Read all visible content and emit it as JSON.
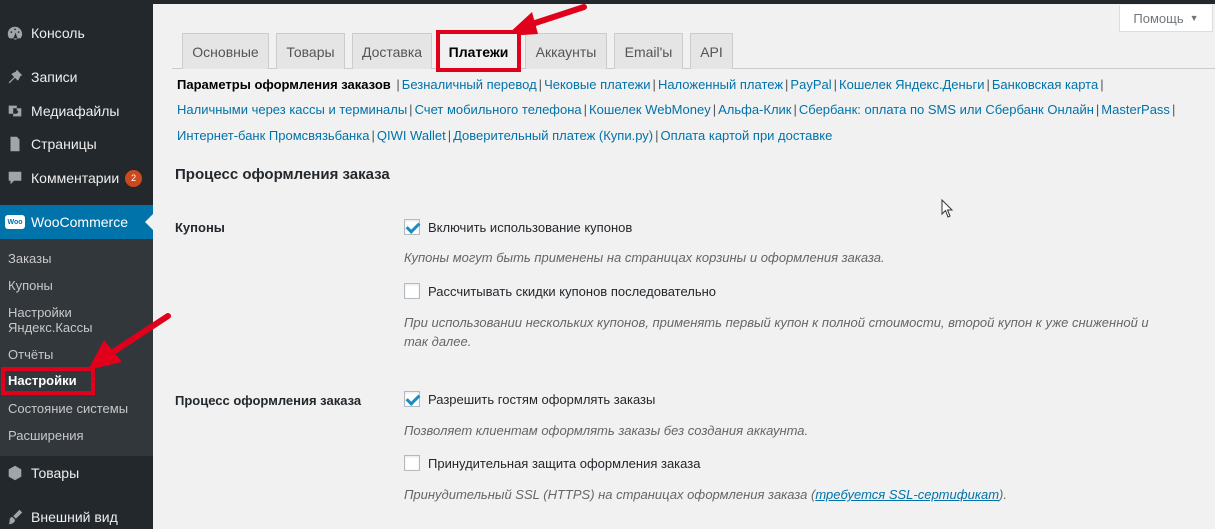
{
  "sidebar": {
    "items": [
      {
        "label": "Консоль",
        "icon": "dashboard-icon"
      },
      {
        "label": "Записи",
        "icon": "pin-icon"
      },
      {
        "label": "Медиафайлы",
        "icon": "media-icon"
      },
      {
        "label": "Страницы",
        "icon": "page-icon"
      },
      {
        "label": "Комментарии",
        "icon": "comment-icon",
        "badge": "2"
      },
      {
        "label": "WooCommerce",
        "icon": "woo-logo-icon",
        "logo_text": "Woo"
      },
      {
        "label": "Товары",
        "icon": "product-box-icon"
      },
      {
        "label": "Внешний вид",
        "icon": "brush-icon"
      }
    ],
    "submenu": [
      "Заказы",
      "Купоны",
      "Настройки Яндекс.Кассы",
      "Отчёты",
      "Настройки",
      "Состояние системы",
      "Расширения"
    ]
  },
  "header": {
    "help_label": "Помощь",
    "help_caret": "▼"
  },
  "tabs": [
    "Основные",
    "Товары",
    "Доставка",
    "Платежи",
    "Аккаунты",
    "Email'ы",
    "API"
  ],
  "sections": {
    "current": "Параметры оформления заказов",
    "line1": [
      "Безналичный перевод",
      "Чековые платежи",
      "Наложенный платеж",
      "PayPal",
      "Кошелек Яндекс.Деньги",
      "Банковская карта"
    ],
    "line2": [
      "Наличными через кассы и терминалы",
      "Счет мобильного телефона",
      "Кошелек WebMoney",
      "Альфа-Клик",
      "Сбербанк: оплата по SMS или Сбербанк Онлайн",
      "MasterPass"
    ],
    "line3": [
      "Интернет-банк Промсвязьбанка",
      "QIWI Wallet",
      "Доверительный платеж (Купи.ру)",
      "Оплата картой при доставке"
    ],
    "separator": "|"
  },
  "form": {
    "heading": "Процесс оформления заказа",
    "coupons": {
      "label": "Купоны",
      "enable_label": "Включить использование купонов",
      "enable_checked": true,
      "enable_desc": "Купоны могут быть применены на страницах корзины и оформления заказа.",
      "sequential_label": "Рассчитывать скидки купонов последовательно",
      "sequential_checked": false,
      "sequential_desc_1": "При использовании нескольких купонов, применять первый купон к полной стоимости, второй купон к уже сниженной и",
      "sequential_desc_2": "так далее."
    },
    "checkout": {
      "label": "Процесс оформления заказа",
      "guest_label": "Разрешить гостям оформлять заказы",
      "guest_checked": true,
      "guest_desc": "Позволяет клиентам оформлять заказы без создания аккаунта.",
      "ssl_label": "Принудительная защита оформления заказа",
      "ssl_checked": false,
      "ssl_desc_prefix": "Принудительный SSL (HTTPS) на страницах оформления заказа (",
      "ssl_desc_link": "требуется SSL-сертификат",
      "ssl_desc_suffix": ")."
    }
  },
  "colors": {
    "sidebar_bg": "#23282d",
    "submenu_bg": "#32373c",
    "accent": "#0073aa",
    "highlight_red": "#e0001b",
    "badge": "#ca4a1f"
  }
}
